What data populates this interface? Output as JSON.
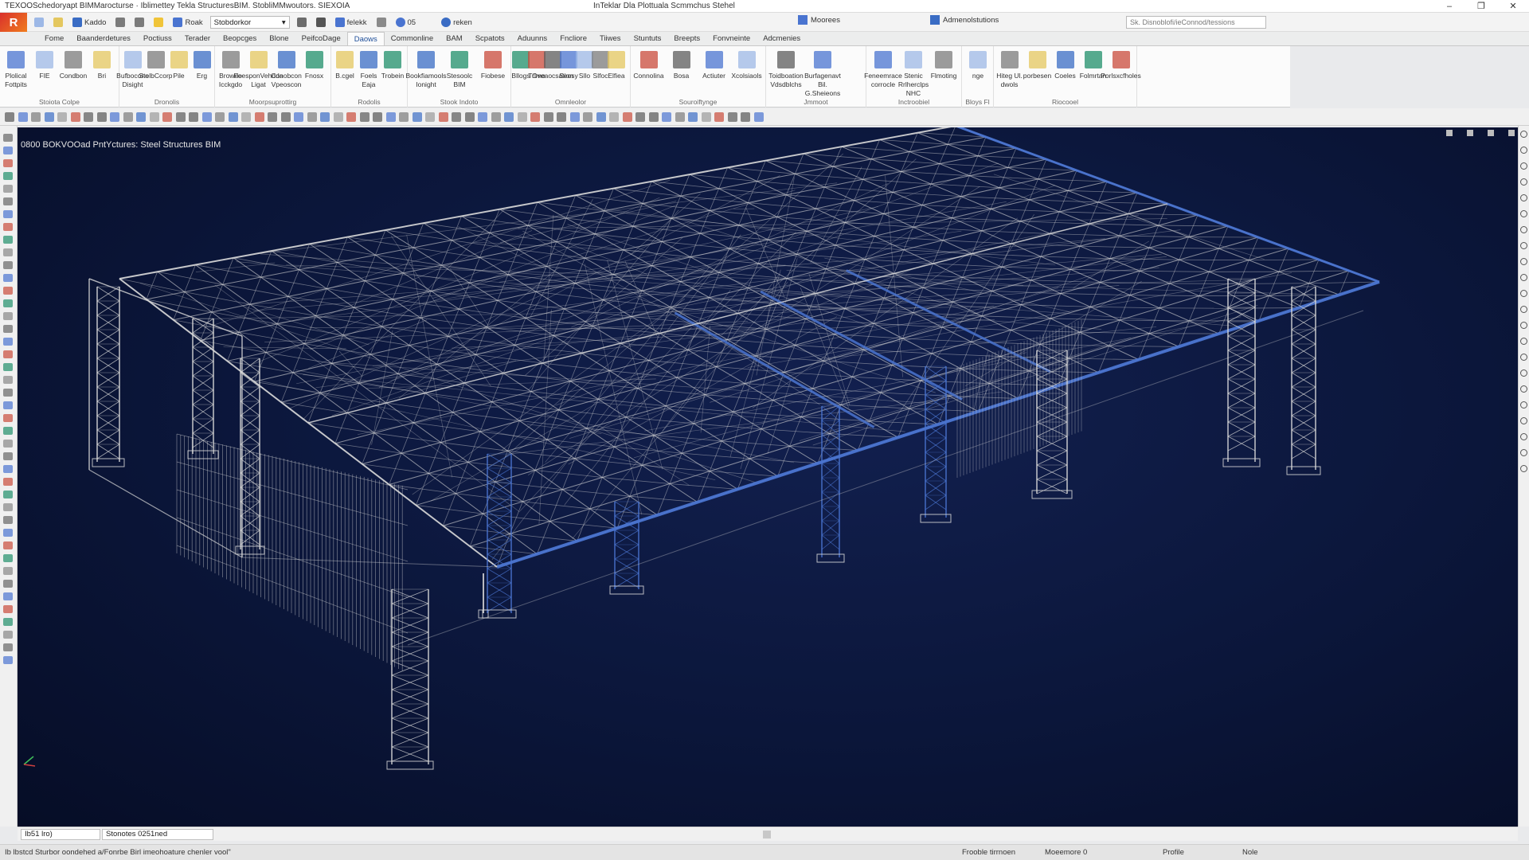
{
  "window": {
    "title": "TEXOOSchedoryapt BIMMarocturse · Iblimettey Tekla StructuresBIM. StobliMMwoutors. SIEXOIA",
    "center_title": "InTeklar Dla Plottuala Scmmchus Stehel",
    "controls": [
      "–",
      "❐",
      "✕"
    ]
  },
  "quick_access": {
    "logo": "R",
    "items": [
      "Kaddo",
      "Roak",
      "Stobdorkor",
      "felekk",
      "05",
      "reken"
    ],
    "combo_value": "Stobdorkor",
    "mid_label": "Moorees",
    "right_label": "Admenolstutions",
    "search_placeholder": "Sk. Disnoblofi/ieConnod/tessions"
  },
  "tabs": [
    {
      "label": "Fome",
      "active": false
    },
    {
      "label": "Baanderdetures",
      "active": false
    },
    {
      "label": "Poctiuss",
      "active": false
    },
    {
      "label": "Terader",
      "active": false
    },
    {
      "label": "Beopcges",
      "active": false
    },
    {
      "label": "Blone",
      "active": false
    },
    {
      "label": "PeifcoDage",
      "active": false
    },
    {
      "label": "Daows",
      "active": true
    },
    {
      "label": "Commonline",
      "active": false
    },
    {
      "label": "BAM",
      "active": false
    },
    {
      "label": "Scpatots",
      "active": false
    },
    {
      "label": "Aduunns",
      "active": false
    },
    {
      "label": "Fncliore",
      "active": false
    },
    {
      "label": "Tiiwes",
      "active": false
    },
    {
      "label": "Stuntuts",
      "active": false
    },
    {
      "label": "Breepts",
      "active": false
    },
    {
      "label": "Fonvneinte",
      "active": false
    },
    {
      "label": "Adcmenies",
      "active": false
    }
  ],
  "ribbon": {
    "groups": [
      {
        "name": "Stoiota Colpe",
        "buttons": [
          "Plolical Fottpits",
          "FIE",
          "Condbon",
          "Bri"
        ]
      },
      {
        "name": "Dronolis",
        "buttons": [
          "Bufbocono Disight",
          "StelbCcorp",
          "Pile",
          "Erg"
        ]
      },
      {
        "name": "Moorpsuprottirg",
        "buttons": [
          "Browdo Icckgdo",
          "FeesponVehdda Ligat",
          "Conobcon Vpeoscon",
          "Fnosx"
        ]
      },
      {
        "name": "Rodolis",
        "buttons": [
          "B.cgel",
          "Foels Eaja",
          "Trobein"
        ]
      },
      {
        "name": "Stook Indoto",
        "buttons": [
          "Bookfiamools Ionight",
          "Stesoolc BIM",
          "Fiobese"
        ]
      },
      {
        "name": "Omnleolor",
        "buttons": [
          "Bllogs",
          "Trlmo",
          "Oveaocsation",
          "Seosy",
          "Sllo",
          "Slfoc",
          "Elfiea"
        ]
      },
      {
        "name": "Souroiftynge",
        "buttons": [
          "Connolina",
          "Bosa",
          "Actiuter",
          "Xcolsiaols"
        ]
      },
      {
        "name": "Jmmoot",
        "buttons": [
          "Toidboation Vdsdblchs",
          "Burfagenavt Bil. G.Sheieons"
        ]
      },
      {
        "name": "Inctroobiel",
        "buttons": [
          "Feneemrace corrocle",
          "Stenic Rrlherclps NHC",
          "Flmoting"
        ]
      },
      {
        "name": "Bloys Fl",
        "buttons": [
          "nge"
        ]
      },
      {
        "name": "Riocooel",
        "buttons": [
          "Hiteg Ul. dwols",
          "porbesen",
          "Coeles",
          "Folmrtan",
          "Porlsxcfholes"
        ]
      }
    ]
  },
  "viewport": {
    "title": "0800 BOKVOOad PntYctures: Steel Structures BIM",
    "units_field": "Ib51 lro)",
    "view_field": "Stonotes 0251ned"
  },
  "status": {
    "message": "Ib lbstcd Sturbor oondehed a/Fonrbe Birl imeohoature chenler vool\"",
    "mode": "Frooble tirrnoen",
    "memory": "Moeemore 0",
    "profile": "Profile",
    "right": "Nole"
  },
  "colors": {
    "viewport_bg": "#0b163a",
    "structure": "#d8d8d8",
    "highlight": "#4a74d0",
    "active_tab": "#1f4f99"
  }
}
